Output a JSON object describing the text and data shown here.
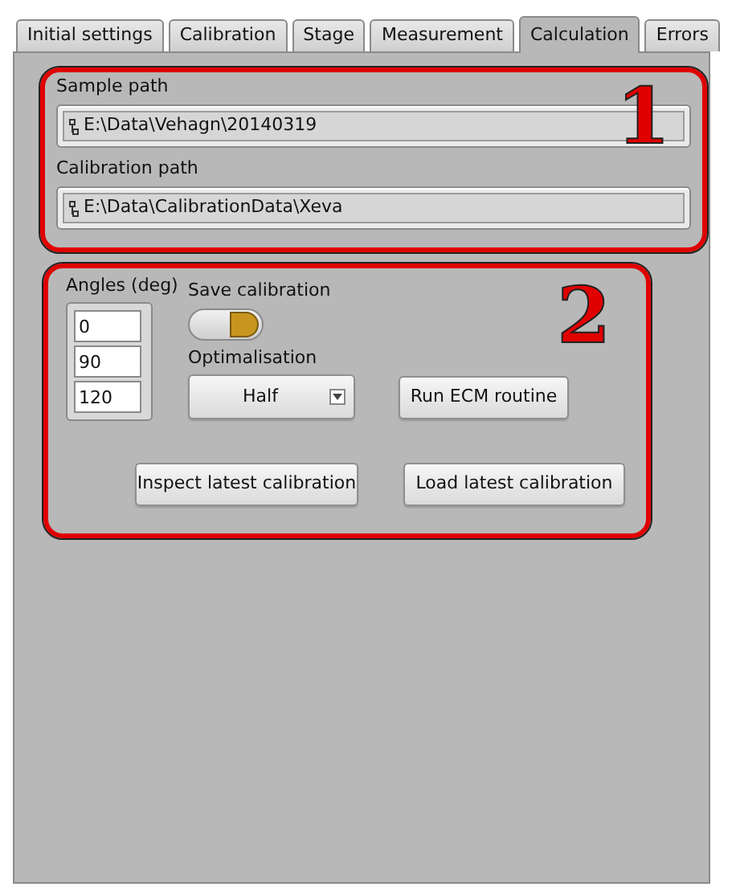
{
  "tabs": [
    {
      "label": "Initial settings",
      "selected": false
    },
    {
      "label": "Calibration",
      "selected": false
    },
    {
      "label": "Stage",
      "selected": false
    },
    {
      "label": "Measurement",
      "selected": false
    },
    {
      "label": "Calculation",
      "selected": true
    },
    {
      "label": "Errors",
      "selected": false
    }
  ],
  "section_1": {
    "marker": "1",
    "sample_path": {
      "label": "Sample path",
      "value": "E:\\Data\\Vehagn\\20140319"
    },
    "calibration_path": {
      "label": "Calibration path",
      "value": "E:\\Data\\CalibrationData\\Xeva"
    }
  },
  "section_2": {
    "marker": "2",
    "angles": {
      "label": "Angles (deg)",
      "values": [
        "0",
        "90",
        "120"
      ]
    },
    "save_calibration": {
      "label": "Save calibration",
      "on": true
    },
    "optimalisation": {
      "label": "Optimalisation",
      "value": "Half"
    },
    "buttons": [
      "Run ECM routine",
      "Inspect latest calibration",
      "Load latest calibration"
    ]
  }
}
